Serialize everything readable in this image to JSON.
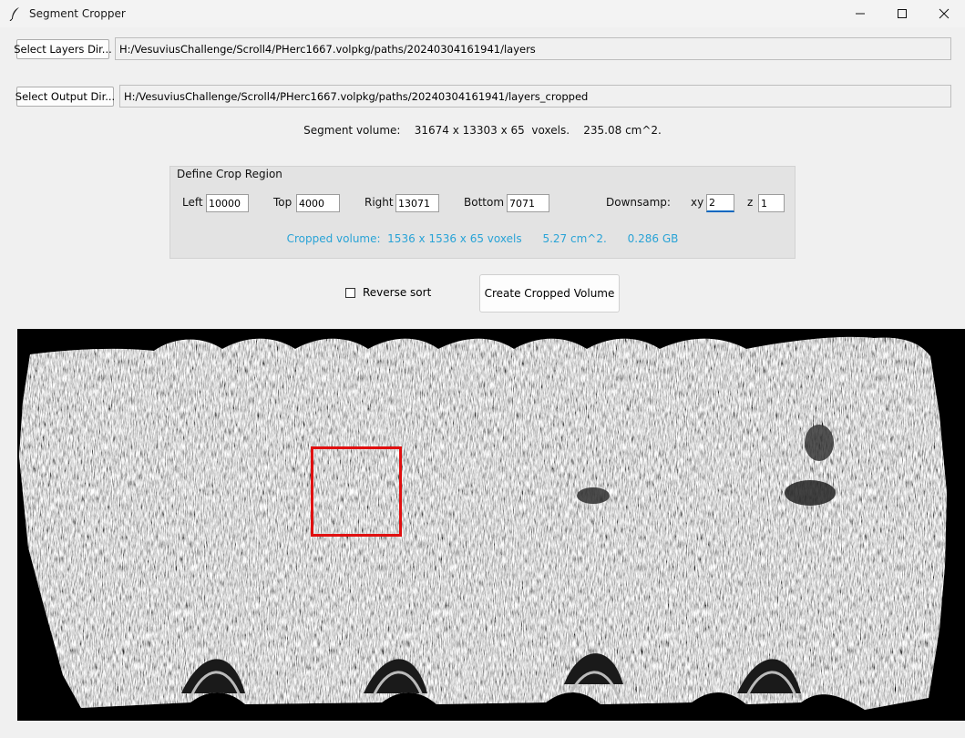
{
  "window": {
    "title": "Segment Cropper",
    "icon": "feather-icon"
  },
  "layers": {
    "button_label": "Select Layers Dir...",
    "path": "H:/VesuviusChallenge/Scroll4/PHerc1667.volpkg/paths/20240304161941/layers"
  },
  "output": {
    "button_label": "Select Output Dir...",
    "path": "H:/VesuviusChallenge/Scroll4/PHerc1667.volpkg/paths/20240304161941/layers_cropped"
  },
  "segment_info": "Segment volume:    31674 x 13303 x 65  voxels.    235.08 cm^2.",
  "crop_region": {
    "title": "Define Crop Region",
    "left_label": "Left",
    "left_value": "10000",
    "top_label": "Top",
    "top_value": "4000",
    "right_label": "Right",
    "right_value": "13071",
    "bottom_label": "Bottom",
    "bottom_value": "7071",
    "downsamp_label": "Downsamp:",
    "xy_label": "xy",
    "xy_value": "2",
    "z_label": "z",
    "z_value": "1",
    "cropped_info": "Cropped volume:  1536 x 1536 x 65 voxels      5.27 cm^2.      0.286 GB",
    "info_color": "#29a3d6"
  },
  "options": {
    "reverse_sort_label": "Reverse sort",
    "reverse_sort_checked": false
  },
  "actions": {
    "create_label": "Create Cropped Volume"
  },
  "preview": {
    "crop_box_color": "#e01010"
  }
}
